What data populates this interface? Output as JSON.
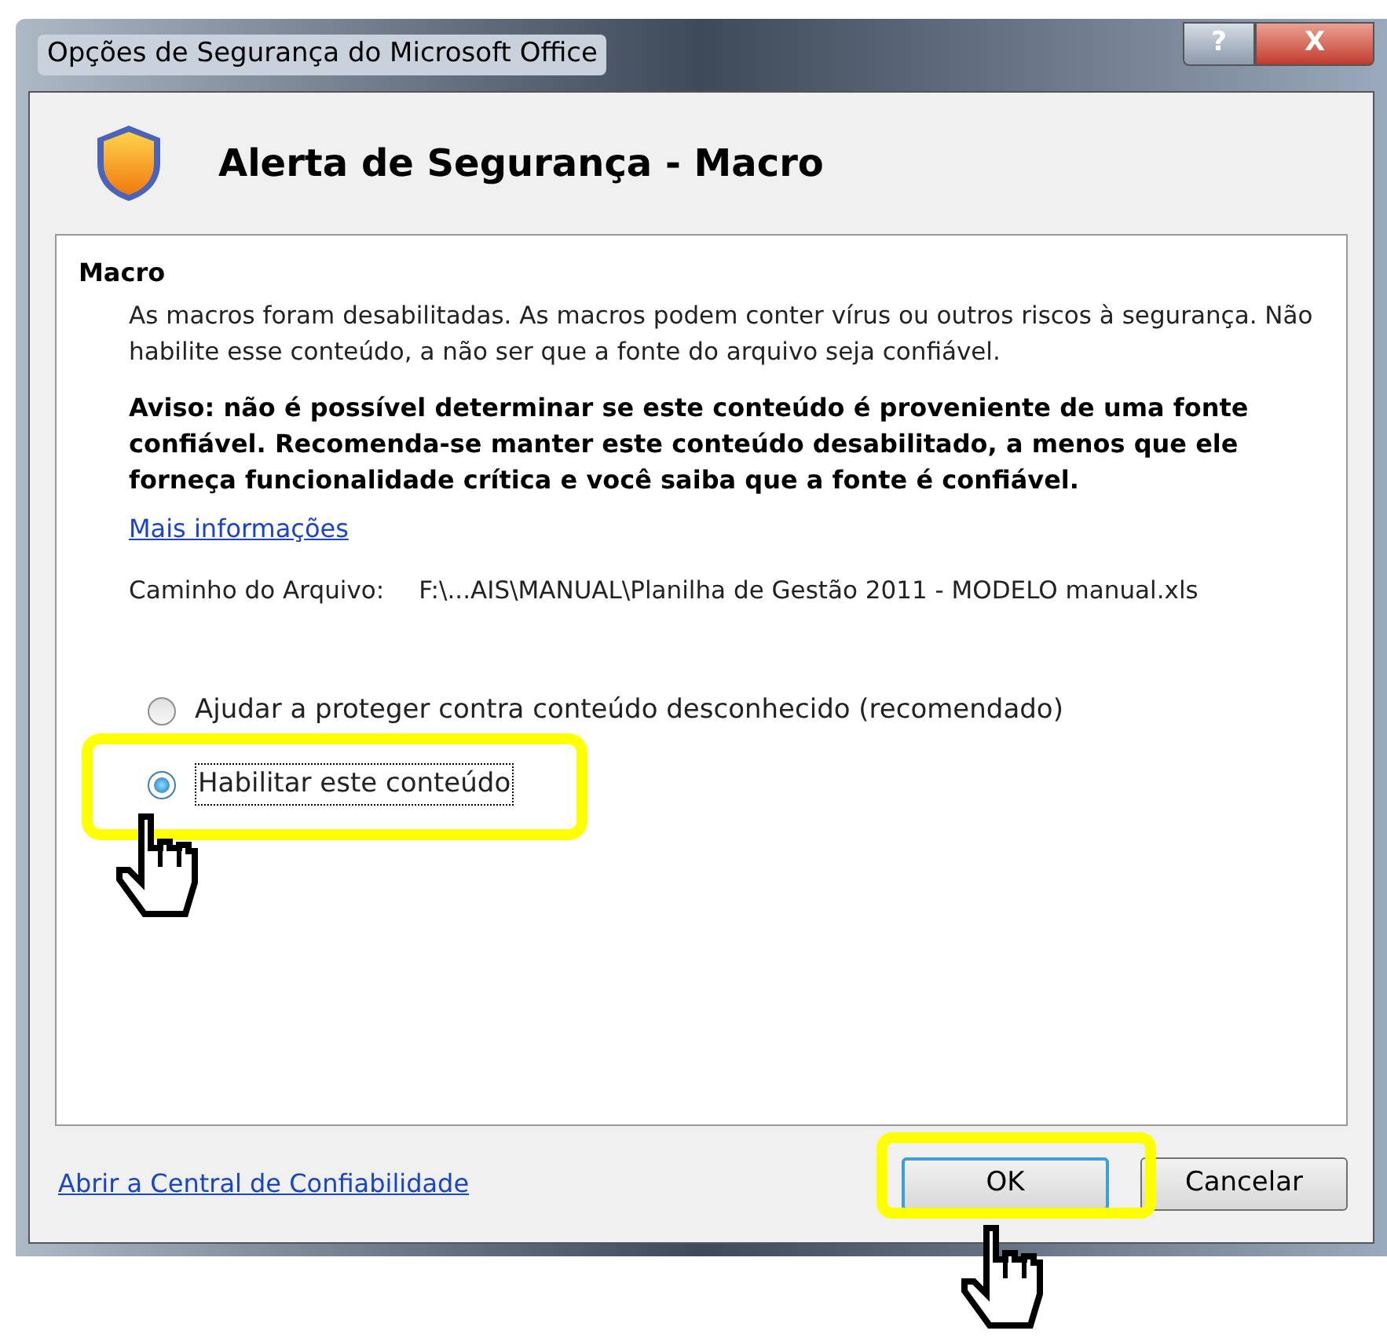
{
  "window": {
    "title": "Opções de Segurança do Microsoft Office",
    "help_button": "?",
    "close_button": "X"
  },
  "header": {
    "title": "Alerta de Segurança - Macro"
  },
  "section": {
    "title": "Macro",
    "description": "As macros foram desabilitadas. As macros podem conter vírus ou outros riscos à segurança. Não habilite esse conteúdo, a não ser que a fonte do arquivo seja confiável.",
    "warning": "Aviso: não é possível determinar se este conteúdo é proveniente de uma fonte confiável. Recomenda-se manter este conteúdo desabilitado, a menos que ele forneça funcionalidade crítica e você saiba que a fonte é confiável.",
    "link": "Mais informações",
    "path_label": "Caminho do Arquivo:",
    "path_value": "F:\\...AIS\\MANUAL\\Planilha de Gestão 2011 - MODELO manual.xls",
    "options": [
      {
        "label": "Ajudar a proteger contra conteúdo desconhecido (recomendado)",
        "selected": false
      },
      {
        "label": "Habilitar este conteúdo",
        "selected": true
      }
    ]
  },
  "footer": {
    "link": "Abrir a Central de Confiabilidade",
    "buttons": [
      {
        "label": "OK",
        "default": true
      },
      {
        "label": "Cancelar",
        "default": false
      }
    ]
  }
}
